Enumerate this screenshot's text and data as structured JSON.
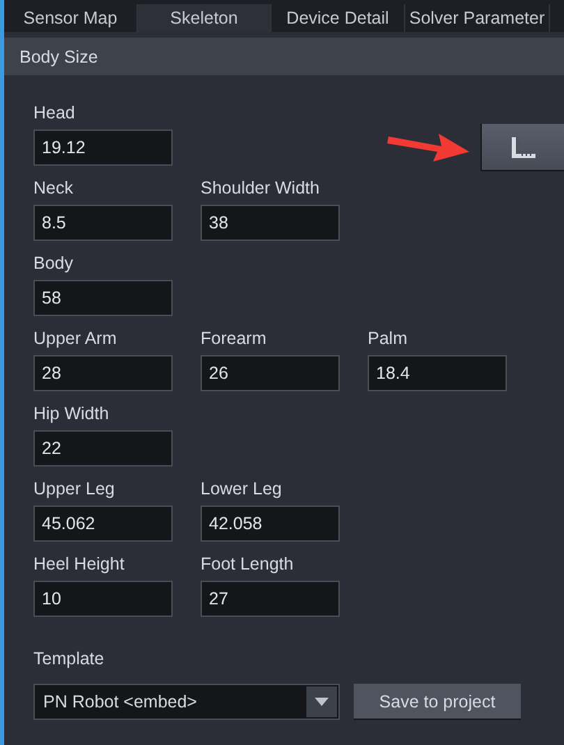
{
  "tabs": [
    {
      "label": "Sensor Map",
      "selected": false
    },
    {
      "label": "Skeleton",
      "selected": true
    },
    {
      "label": "Device Detail",
      "selected": false
    },
    {
      "label": "Solver Parameter",
      "selected": false
    }
  ],
  "section": {
    "title": "Body Size"
  },
  "field_rows": [
    [
      {
        "label": "Head",
        "value": "19.12"
      }
    ],
    [
      {
        "label": "Neck",
        "value": "8.5"
      },
      {
        "label": "Shoulder Width",
        "value": "38"
      }
    ],
    [
      {
        "label": "Body",
        "value": "58"
      }
    ],
    [
      {
        "label": "Upper Arm",
        "value": "28"
      },
      {
        "label": "Forearm",
        "value": "26"
      },
      {
        "label": "Palm",
        "value": "18.4"
      }
    ],
    [
      {
        "label": "Hip Width",
        "value": "22"
      }
    ],
    [
      {
        "label": "Upper Leg",
        "value": "45.062"
      },
      {
        "label": "Lower Leg",
        "value": "42.058"
      }
    ],
    [
      {
        "label": "Heel Height",
        "value": "10"
      },
      {
        "label": "Foot Length",
        "value": "27"
      }
    ]
  ],
  "template": {
    "label": "Template",
    "value": "PN Robot <embed>",
    "button": "Save to project"
  }
}
